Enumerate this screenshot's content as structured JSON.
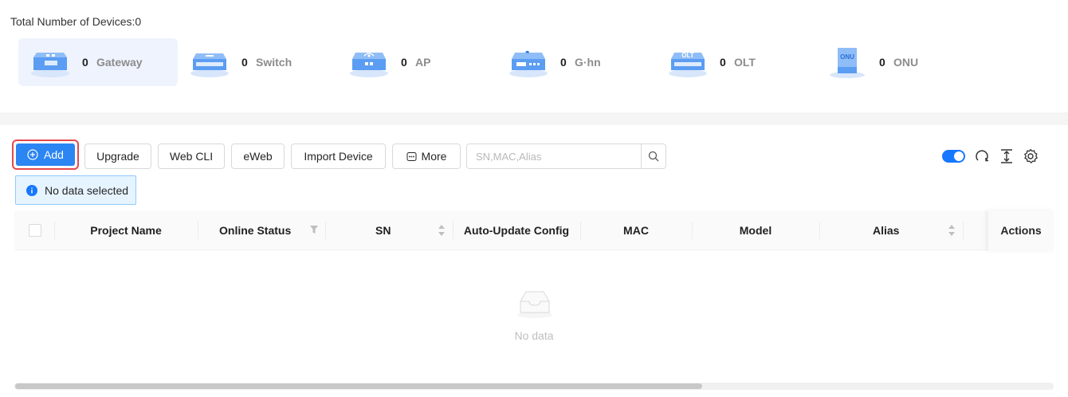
{
  "summary": {
    "total_label": "Total Number of Devices:0",
    "devices": [
      {
        "count": "0",
        "label": "Gateway",
        "icon": "gateway-icon",
        "active": true
      },
      {
        "count": "0",
        "label": "Switch",
        "icon": "switch-icon",
        "active": false
      },
      {
        "count": "0",
        "label": "AP",
        "icon": "ap-icon",
        "active": false
      },
      {
        "count": "0",
        "label": "G·hn",
        "icon": "ghn-icon",
        "active": false
      },
      {
        "count": "0",
        "label": "OLT",
        "icon": "olt-icon",
        "active": false
      },
      {
        "count": "0",
        "label": "ONU",
        "icon": "onu-icon",
        "active": false
      }
    ],
    "olt_badge": "OLT",
    "onu_badge": "ONU"
  },
  "toolbar": {
    "add_label": "Add",
    "upgrade_label": "Upgrade",
    "webcli_label": "Web CLI",
    "eweb_label": "eWeb",
    "import_label": "Import Device",
    "more_label": "More",
    "search_placeholder": "SN,MAC,Alias",
    "toggle_on": true
  },
  "alert": {
    "text": "No data selected"
  },
  "table": {
    "columns": {
      "project_name": "Project Name",
      "online_status": "Online Status",
      "sn": "SN",
      "auto_update": "Auto-Update Config",
      "mac": "MAC",
      "model": "Model",
      "alias": "Alias",
      "actions": "Actions"
    },
    "rows": [],
    "empty_text": "No data"
  },
  "colors": {
    "primary": "#2b85f2",
    "highlight_border": "#e5484d",
    "alert_bg": "#e6f4ff",
    "toggle": "#1677ff"
  }
}
